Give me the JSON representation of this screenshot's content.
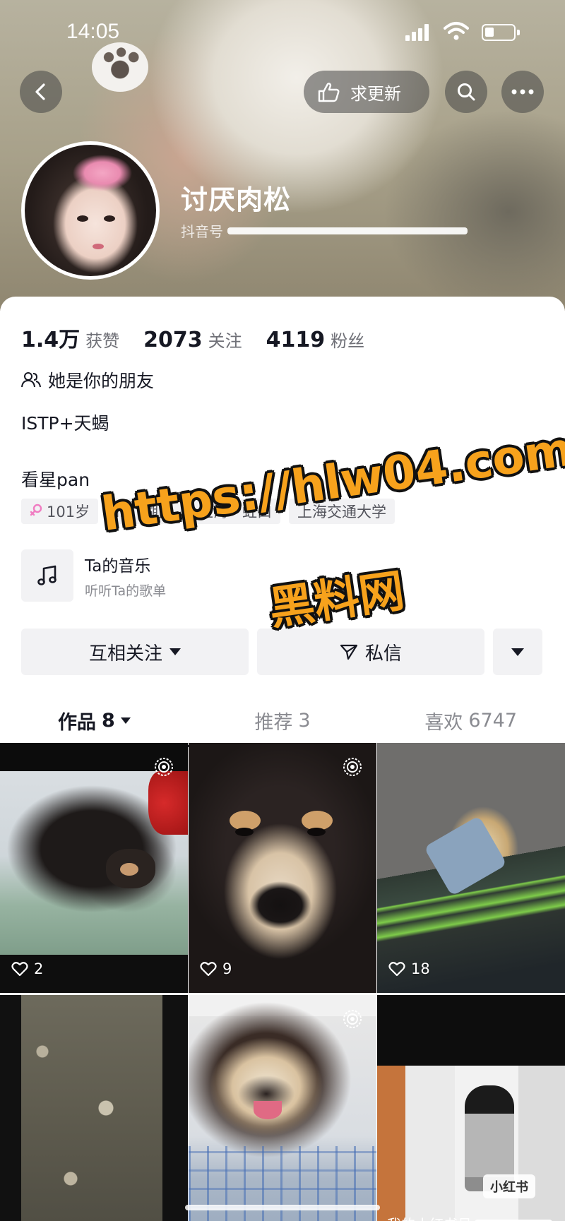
{
  "status_bar": {
    "time": "14:05"
  },
  "header": {
    "update_label": "求更新",
    "icons": [
      "back-arrow-icon",
      "hand-point-icon",
      "search-icon",
      "more-dots-icon"
    ]
  },
  "profile": {
    "nickname": "讨厌肉松",
    "account_prefix": "抖音号",
    "stats": [
      {
        "value": "1.4万",
        "label": "获赞"
      },
      {
        "value": "2073",
        "label": "关注"
      },
      {
        "value": "4119",
        "label": "粉丝"
      }
    ],
    "relation": "她是你的朋友",
    "bio_line1": "ISTP+天蝎",
    "bio_line2": "看星pan",
    "tags": [
      {
        "text": "101岁",
        "icon": "female-icon"
      },
      {
        "text": "IP：湖南"
      },
      {
        "text": "上海 · 虹口"
      },
      {
        "text": "上海交通大学"
      }
    ],
    "music": {
      "title": "Ta的音乐",
      "subtitle": "听听Ta的歌单"
    }
  },
  "actions": {
    "follow_label": "互相关注",
    "message_label": "私信"
  },
  "tabs": [
    {
      "label": "作品",
      "count": "8"
    },
    {
      "label": "推荐",
      "count": "3"
    },
    {
      "label": "喜欢",
      "count": "6747"
    }
  ],
  "videos": [
    {
      "likes": "2"
    },
    {
      "likes": "9"
    },
    {
      "likes": "18"
    },
    {
      "likes": ""
    },
    {
      "likes": ""
    },
    {
      "likes": "",
      "badge": "小红书",
      "caption": "我的小红书号"
    }
  ],
  "watermark": {
    "line1": "https://hlw04.com",
    "line2": "黑料网"
  },
  "colors": {
    "watermark_fill": "#f7a21c",
    "watermark_stroke": "#111111",
    "text_primary": "#161823",
    "text_secondary": "#6f7077",
    "button_bg": "#f2f2f4",
    "female_pink": "#f07dc2"
  }
}
